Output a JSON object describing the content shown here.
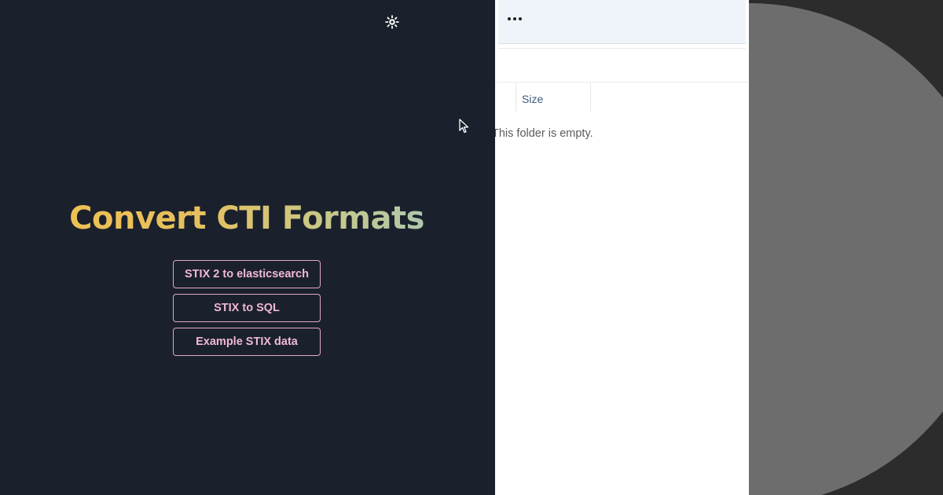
{
  "app": {
    "title": "Convert CTI Formats",
    "buttons": [
      {
        "label": "STIX 2 to elasticsearch"
      },
      {
        "label": "STIX to SQL"
      },
      {
        "label": "Example STIX data"
      }
    ],
    "theme_toggle_icon": "sun-icon",
    "colors": {
      "background": "#1b212c",
      "button_border": "#e0a8c8",
      "button_text": "#f0b8d4",
      "title_gradient": [
        "#f2c14e",
        "#9ec5c8"
      ]
    }
  },
  "explorer": {
    "toolbar": {
      "more_icon": "more-horizontal-icon"
    },
    "columns": [
      {
        "label": "Size"
      }
    ],
    "empty_message": "This folder is empty."
  }
}
